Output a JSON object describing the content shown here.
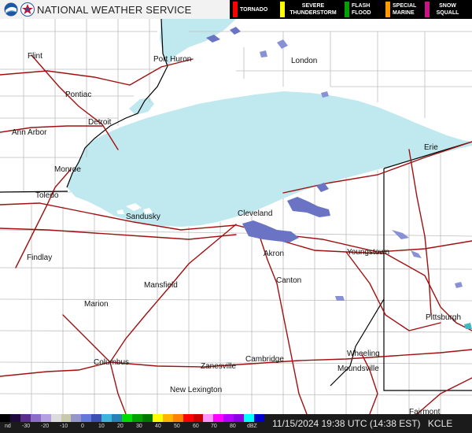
{
  "header": {
    "title": "NATIONAL WEATHER SERVICE",
    "logos": [
      "noaa-logo",
      "nws-logo"
    ]
  },
  "warnings_legend": [
    {
      "label": "TORNADO",
      "color": "#ff0000"
    },
    {
      "label": "SEVERE THUNDERSTORM",
      "color": "#ffff00"
    },
    {
      "label": "FLASH FLOOD",
      "color": "#00a000"
    },
    {
      "label": "SPECIAL MARINE",
      "color": "#ff9900"
    },
    {
      "label": "SNOW SQUALL",
      "color": "#c71585"
    }
  ],
  "map": {
    "water_color": "#bfe8ef",
    "road_color": "#a01010",
    "county_color": "#bdbdbd",
    "state_line_color": "#000000",
    "precip_colors": [
      "#6b74c4",
      "#8891d6",
      "#3fb9c0"
    ],
    "cities": [
      "Flint",
      "Port Huron",
      "London",
      "Pontiac",
      "Detroit",
      "Ann Arbor",
      "Monroe",
      "Toledo",
      "Sandusky",
      "Cleveland",
      "Erie",
      "Findlay",
      "Akron",
      "Youngstown",
      "Mansfield",
      "Canton",
      "Marion",
      "Pittsburgh",
      "Wheeling",
      "Columbus",
      "Cambridge",
      "Zanesville",
      "Moundsville",
      "New Lexington",
      "Fairmont"
    ]
  },
  "scale": {
    "labels": [
      "nd",
      "-30",
      "-20",
      "-10",
      "0",
      "10",
      "20",
      "30",
      "40",
      "50",
      "60",
      "70",
      "80",
      "dBZ"
    ],
    "colors": [
      "#000000",
      "#1e0a3c",
      "#5a2d8c",
      "#8c6ec8",
      "#b4a0e0",
      "#dcdcdc",
      "#c8c8aa",
      "#9696c8",
      "#6478dc",
      "#3c50b4",
      "#3cb4dc",
      "#2882b4",
      "#00dc00",
      "#00a000",
      "#007800",
      "#ffff00",
      "#ffb400",
      "#ff8200",
      "#ff0000",
      "#c80000",
      "#ff96ff",
      "#ff00ff",
      "#b400ff",
      "#8c00e6",
      "#00ffff",
      "#0000c8"
    ]
  },
  "footer": {
    "timestamp": "11/15/2024 19:38 UTC (14:38 EST)",
    "station": "KCLE"
  }
}
